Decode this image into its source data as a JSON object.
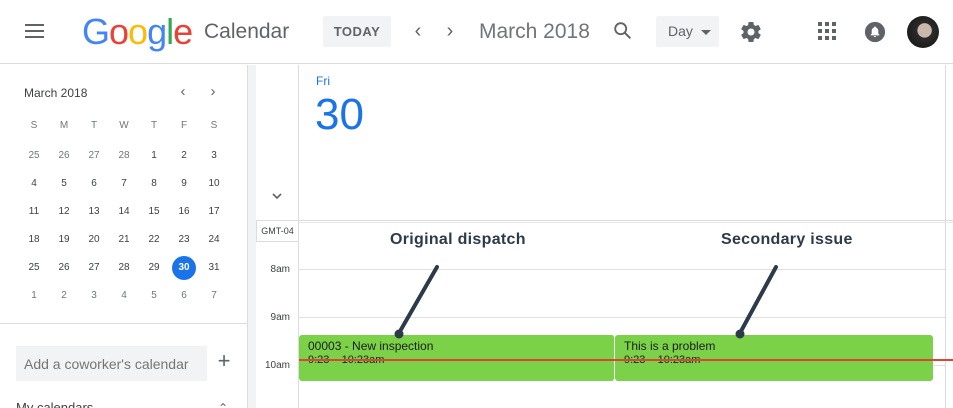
{
  "header": {
    "menu_icon": "hamburger-menu-icon",
    "logo_letters": [
      "G",
      "o",
      "o",
      "g",
      "l",
      "e"
    ],
    "product": "Calendar",
    "today_label": "TODAY",
    "prev_icon": "chevron-left-icon",
    "next_icon": "chevron-right-icon",
    "current_period": "March 2018",
    "view_label": "Day",
    "colors": {
      "blue": "#4285f4",
      "red": "#ea4335",
      "yellow": "#fbbc05",
      "green": "#34a853",
      "accent": "#1a73e8"
    }
  },
  "mini_calendar": {
    "title": "March 2018",
    "weekdays": [
      "S",
      "M",
      "T",
      "W",
      "T",
      "F",
      "S"
    ],
    "weeks": [
      [
        "25",
        "26",
        "27",
        "28",
        "1",
        "2",
        "3"
      ],
      [
        "4",
        "5",
        "6",
        "7",
        "8",
        "9",
        "10"
      ],
      [
        "11",
        "12",
        "13",
        "14",
        "15",
        "16",
        "17"
      ],
      [
        "18",
        "19",
        "20",
        "21",
        "22",
        "23",
        "24"
      ],
      [
        "25",
        "26",
        "27",
        "28",
        "29",
        "30",
        "31"
      ],
      [
        "1",
        "2",
        "3",
        "4",
        "5",
        "6",
        "7"
      ]
    ],
    "selected_day": "30"
  },
  "sidebar": {
    "coworker_placeholder": "Add a coworker's calendar",
    "add_symbol": "+",
    "my_calendars": "My calendars"
  },
  "day_view": {
    "day_of_week": "Fri",
    "day_number": "30",
    "timezone": "GMT-04",
    "hours": [
      "8am",
      "9am",
      "10am"
    ],
    "events": [
      {
        "title": "00003 - New inspection",
        "time": "9:23 – 10:23am"
      },
      {
        "title": "This is a problem",
        "time": "9:23 – 10:23am"
      }
    ],
    "event_color": "#7bd148",
    "now_line_color": "#db4437"
  },
  "annotations": {
    "first": "Original dispatch",
    "second": "Secondary issue"
  }
}
